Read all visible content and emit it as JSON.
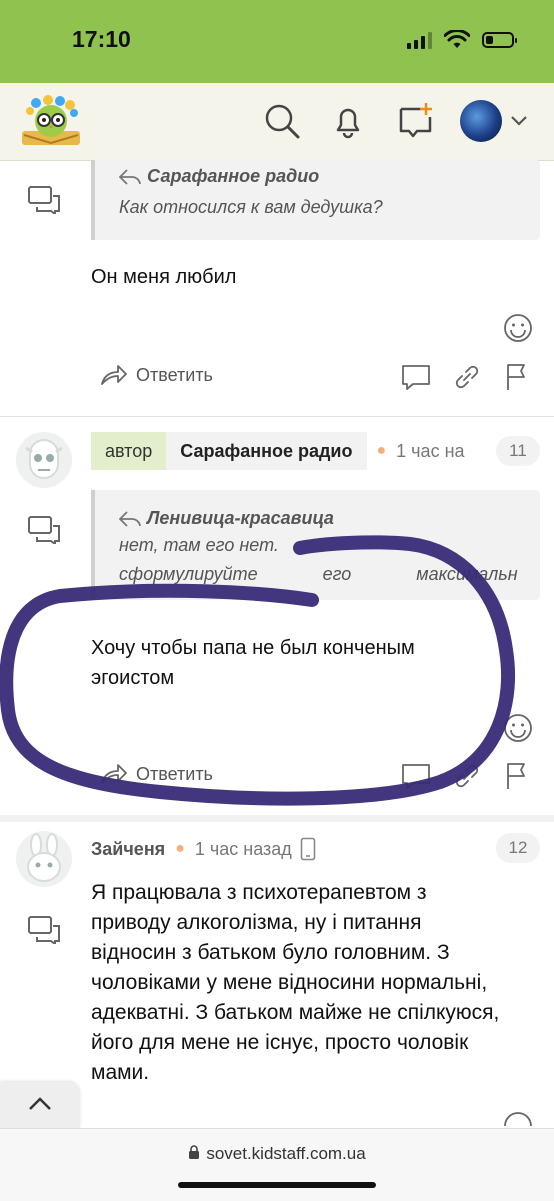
{
  "status_bar": {
    "time": "17:10",
    "battery_level": 0.3
  },
  "header": {
    "logo": "kidstaff-owl-logo",
    "icons": [
      "search-icon",
      "bell-icon",
      "new-message-icon",
      "avatar",
      "chevron-down-icon"
    ]
  },
  "comments": [
    {
      "quote_author": "Сарафанное радио",
      "quote_text": "Как относился к вам дедушка?",
      "text": "Он меня любил",
      "reply_label": "Ответить"
    },
    {
      "author_tag": "автор",
      "author": "Сарафанное радио",
      "time": "1 час на",
      "count": "11",
      "quote_author": "Ленивица-красавица",
      "quote_lines": [
        "нет, там его нет.",
        "сформулируйте его максимальн"
      ],
      "text_lines": [
        "Хочу чтобы папа не был конченым",
        "эгоистом"
      ],
      "reply_label": "Ответить"
    },
    {
      "author": "Зайченя",
      "time": "1 час назад",
      "count": "12",
      "text_lines": [
        "Я працювала з психотерапевтом з",
        "приводу алкоголізма, ну і питання",
        "відносин з батьком було головним. З",
        "чоловіками у мене відносини нормальні,",
        "адекватні. З батьком майже не спілкуюся,",
        "його для мене не існує, просто чоловік",
        "мами."
      ]
    }
  ],
  "url_bar": {
    "url": "sovet.kidstaff.com.ua"
  },
  "colors": {
    "status_bar": "#8fc24f",
    "header_bg": "#f5f4ea",
    "author_tag_bg": "#e3efcc",
    "scribble": "#3a2a78"
  }
}
